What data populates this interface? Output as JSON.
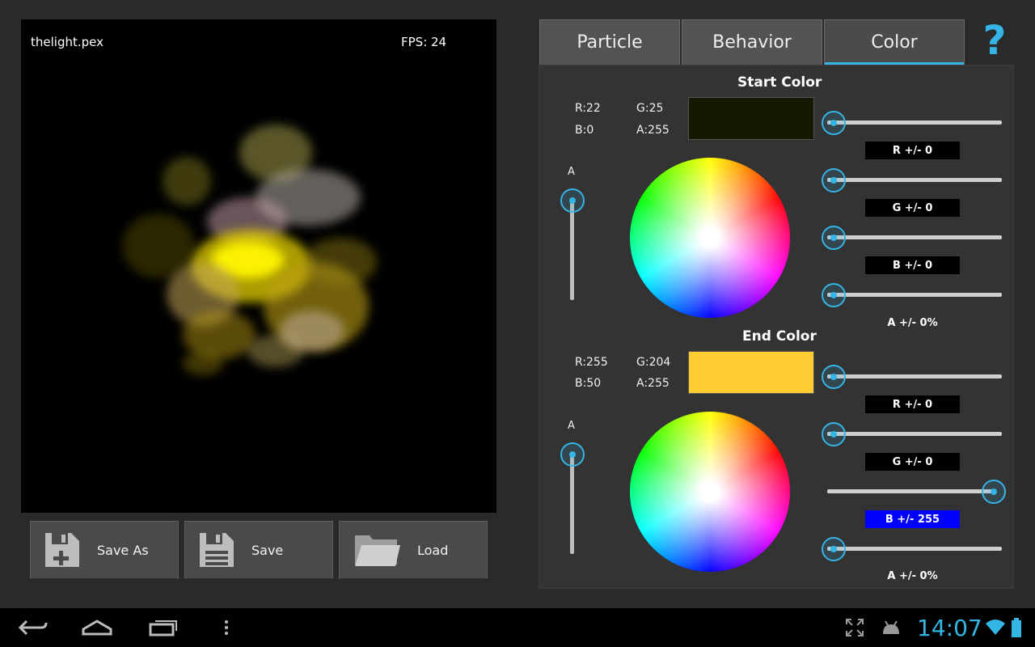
{
  "preview": {
    "filename": "thelight.pex",
    "fps": "FPS: 24"
  },
  "buttons": {
    "save_as": "Save As",
    "save": "Save",
    "load": "Load"
  },
  "tabs": [
    {
      "label": "Particle",
      "active": false
    },
    {
      "label": "Behavior",
      "active": false
    },
    {
      "label": "Color",
      "active": true
    }
  ],
  "help_label": "?",
  "start_color": {
    "title": "Start Color",
    "r": "R:22",
    "g": "G:25",
    "b": "B:0",
    "a": "A:255",
    "swatch": "#161900",
    "alpha_label": "A",
    "variance": {
      "r_label": "R +/- 0",
      "g_label": "G +/- 0",
      "b_label": "B +/- 0",
      "a_label": "A +/- 0%",
      "r": 0,
      "g": 0,
      "b": 0,
      "a": 0
    }
  },
  "end_color": {
    "title": "End Color",
    "r": "R:255",
    "g": "G:204",
    "b": "B:50",
    "a": "A:255",
    "swatch": "#ffcc32",
    "alpha_label": "A",
    "variance": {
      "r_label": "R +/- 0",
      "g_label": "G +/- 0",
      "b_label": "B +/- 255",
      "a_label": "A +/- 0%",
      "r": 0,
      "g": 0,
      "b": 255,
      "a": 0
    }
  },
  "status": {
    "time": "14:07"
  },
  "colors": {
    "accent": "#33b5e5",
    "highlight": "#0000ff"
  }
}
